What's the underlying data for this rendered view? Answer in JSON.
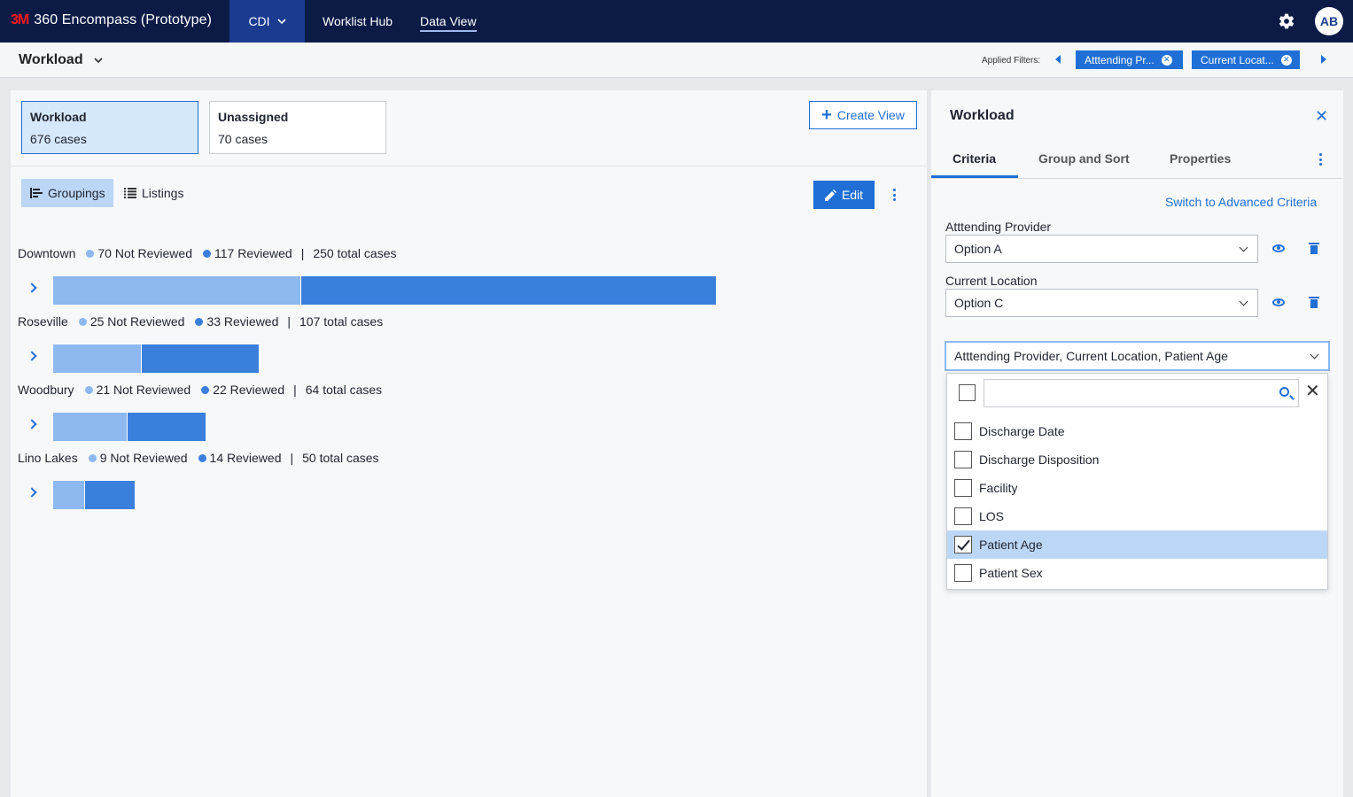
{
  "app": {
    "brand_logo": "3M",
    "title": "360 Encompass (Prototype)",
    "nav": [
      {
        "label": "CDI"
      },
      {
        "label": "Worklist Hub"
      },
      {
        "label": "Data View"
      }
    ],
    "avatar": "AB"
  },
  "subheader": {
    "title": "Workload",
    "filters_label": "Applied Filters:",
    "chips": [
      "Atttending Pr...",
      "Current Locat..."
    ]
  },
  "views": [
    {
      "name": "Workload",
      "count": "676 cases"
    },
    {
      "name": "Unassigned",
      "count": "70 cases"
    }
  ],
  "create_view_label": "Create View",
  "toolbar": {
    "groupings": "Groupings",
    "listings": "Listings",
    "edit": "Edit"
  },
  "chart_data": {
    "type": "bar",
    "orientation": "horizontal-stacked",
    "categories": [
      "Downtown",
      "Roseville",
      "Woodbury",
      "Lino Lakes"
    ],
    "series": [
      {
        "name": "Not Reviewed",
        "values": [
          70,
          25,
          21,
          9
        ]
      },
      {
        "name": "Reviewed",
        "values": [
          117,
          33,
          22,
          14
        ]
      }
    ],
    "labels": [
      {
        "not_reviewed": "70 Not Reviewed",
        "reviewed": "117 Reviewed",
        "total": "250 total cases"
      },
      {
        "not_reviewed": "25 Not Reviewed",
        "reviewed": "33 Reviewed",
        "total": "107 total cases"
      },
      {
        "not_reviewed": "21 Not Reviewed",
        "reviewed": "22 Reviewed",
        "total": "64 total cases"
      },
      {
        "not_reviewed": "9 Not Reviewed",
        "reviewed": "14 Reviewed",
        "total": "50 total cases"
      }
    ],
    "colors": {
      "not_reviewed": "#8db8f0",
      "reviewed": "#3b7fdc"
    }
  },
  "panel": {
    "title": "Workload",
    "tabs": [
      "Criteria",
      "Group and Sort",
      "Properties"
    ],
    "advanced_link": "Switch to Advanced Criteria",
    "fields": [
      {
        "label": "Atttending Provider",
        "value": "Option A"
      },
      {
        "label": "Current Location",
        "value": "Option C"
      }
    ],
    "multiselect_value": "Atttending Provider, Current Location, Patient Age",
    "options": [
      {
        "label": "Discharge Date",
        "checked": false
      },
      {
        "label": "Discharge Disposition",
        "checked": false
      },
      {
        "label": "Facility",
        "checked": false
      },
      {
        "label": "LOS",
        "checked": false
      },
      {
        "label": "Patient Age",
        "checked": true
      },
      {
        "label": "Patient Sex",
        "checked": false
      }
    ]
  },
  "colors": {
    "accent": "#1f6fd6",
    "nav_bg": "#0b1b46",
    "nav_active": "#1a3b8f"
  }
}
